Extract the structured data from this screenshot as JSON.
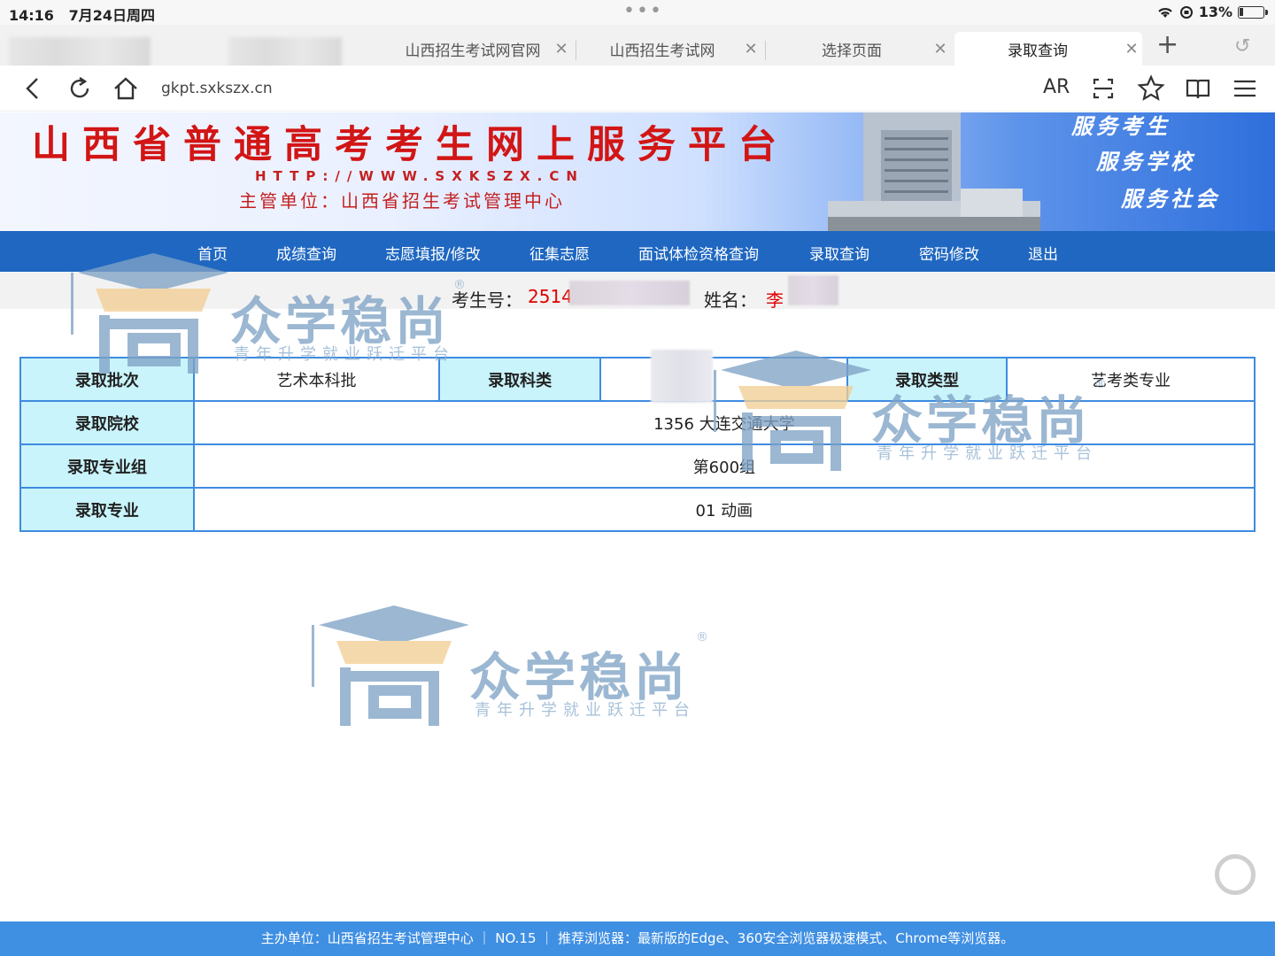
{
  "status_bar": {
    "time": "14:16",
    "date": "7月24日周四",
    "battery": "13%"
  },
  "tabs": [
    {
      "label": "山西招生考试网官网"
    },
    {
      "label": "山西招生考试网"
    },
    {
      "label": "选择页面"
    },
    {
      "label": "录取查询",
      "active": true
    }
  ],
  "toolbar": {
    "url": "gkpt.sxkszx.cn",
    "ar_label": "AR"
  },
  "banner": {
    "title": "山西省普通高考考生网上服务平台",
    "url": "HTTP://WWW.SXKSZX.CN",
    "org": "主管单位：山西省招生考试管理中心",
    "slogans": [
      "服务考生",
      "服务学校",
      "服务社会"
    ]
  },
  "nav": {
    "items": [
      "首页",
      "成绩查询",
      "志愿填报/修改",
      "征集志愿",
      "面试体检资格查询",
      "录取查询",
      "密码修改",
      "退出"
    ]
  },
  "student": {
    "id_label": "考生号：",
    "id_value": "2514",
    "name_label": "姓名：",
    "name_value": "李"
  },
  "result": {
    "batch_label": "录取批次",
    "batch_value": "艺术本科批",
    "subject_label": "录取科类",
    "subject_value": "",
    "type_label": "录取类型",
    "type_value": "艺考类专业",
    "school_label": "录取院校",
    "school_value": "1356 大连交通大学",
    "group_label": "录取专业组",
    "group_value": "第600组",
    "major_label": "录取专业",
    "major_value": "01 动画"
  },
  "watermark": {
    "brand": "众学稳尚",
    "tagline": "青年升学就业跃迁平台",
    "reg": "®"
  },
  "footer": {
    "text": "主办单位：山西省招生考试管理中心  ｜ NO.15 ｜  推荐浏览器：最新版的Edge、360安全浏览器极速模式、Chrome等浏览器。"
  },
  "colors": {
    "nav_bg": "#1f67c1",
    "footer_bg": "#3f8fe3",
    "header_cell_bg": "#c9f4fb",
    "accent_red": "#d21515",
    "table_border": "#3e8be0"
  }
}
